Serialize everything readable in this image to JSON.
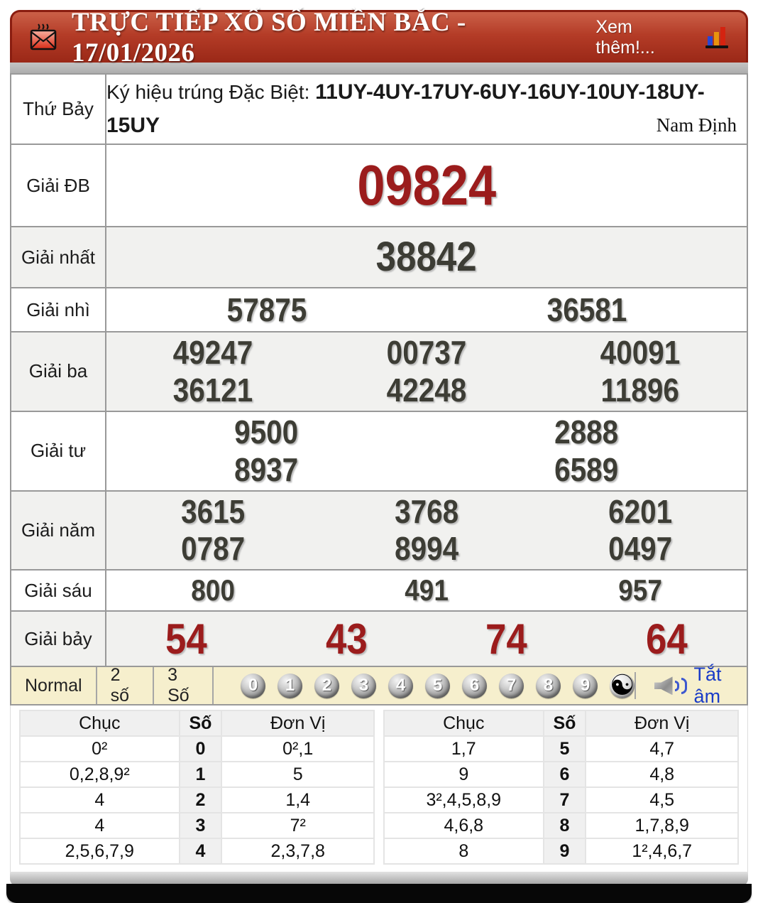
{
  "colors": {
    "header_red": "#b43c27",
    "accent_red": "#9b1c1c",
    "number_dark": "#3d3d35",
    "toolbar_cream": "#f6efcd",
    "link_blue": "#1a3cc8"
  },
  "header": {
    "title": "TRỰC TIẾP XỔ SỐ MIỀN BẮC - 17/01/2026",
    "more_link": "Xem thêm!...",
    "envelope_icon": "hot-envelope-icon",
    "chart_icon": "bar-chart-icon"
  },
  "results": {
    "day": "Thứ Bảy",
    "symbol_label": "Ký hiệu trúng Đặc Biệt:",
    "symbol_codes": "11UY-4UY-17UY-6UY-16UY-10UY-18UY-15UY",
    "province": "Nam Định",
    "rows": [
      {
        "label": "Giải ĐB",
        "numbers": [
          [
            "09824"
          ]
        ]
      },
      {
        "label": "Giải nhất",
        "numbers": [
          [
            "38842"
          ]
        ]
      },
      {
        "label": "Giải nhì",
        "numbers": [
          [
            "57875",
            "36581"
          ]
        ]
      },
      {
        "label": "Giải ba",
        "numbers": [
          [
            "49247",
            "00737",
            "40091"
          ],
          [
            "36121",
            "42248",
            "11896"
          ]
        ]
      },
      {
        "label": "Giải tư",
        "numbers": [
          [
            "9500",
            "2888"
          ],
          [
            "8937",
            "6589"
          ]
        ]
      },
      {
        "label": "Giải năm",
        "numbers": [
          [
            "3615",
            "3768",
            "6201"
          ],
          [
            "0787",
            "8994",
            "0497"
          ]
        ]
      },
      {
        "label": "Giải sáu",
        "numbers": [
          [
            "800",
            "491",
            "957"
          ]
        ]
      },
      {
        "label": "Giải bảy",
        "numbers": [
          [
            "54",
            "43",
            "74",
            "64"
          ]
        ]
      }
    ]
  },
  "toolbar": {
    "modes": [
      "Normal",
      "2 số",
      "3 Số"
    ],
    "balls": [
      "0",
      "1",
      "2",
      "3",
      "4",
      "5",
      "6",
      "7",
      "8",
      "9"
    ],
    "yinyang_icon": "yin-yang-icon",
    "yinyang_glyph": "☯",
    "speaker_icon": "speaker-icon",
    "mute_label": "Tắt âm"
  },
  "loto": {
    "headers": [
      "Chục",
      "Số",
      "Đơn Vị"
    ],
    "left_rows": [
      {
        "chuc": "0²",
        "so": "0",
        "donvi": "0²,1"
      },
      {
        "chuc": "0,2,8,9²",
        "so": "1",
        "donvi": "5"
      },
      {
        "chuc": "4",
        "so": "2",
        "donvi": "1,4"
      },
      {
        "chuc": "4",
        "so": "3",
        "donvi": "7²"
      },
      {
        "chuc": "2,5,6,7,9",
        "so": "4",
        "donvi": "2,3,7,8"
      }
    ],
    "right_rows": [
      {
        "chuc": "1,7",
        "so": "5",
        "donvi": "4,7"
      },
      {
        "chuc": "9",
        "so": "6",
        "donvi": "4,8"
      },
      {
        "chuc": "3²,4,5,8,9",
        "so": "7",
        "donvi": "4,5"
      },
      {
        "chuc": "4,6,8",
        "so": "8",
        "donvi": "1,7,8,9"
      },
      {
        "chuc": "8",
        "so": "9",
        "donvi": "1²,4,6,7"
      }
    ]
  }
}
